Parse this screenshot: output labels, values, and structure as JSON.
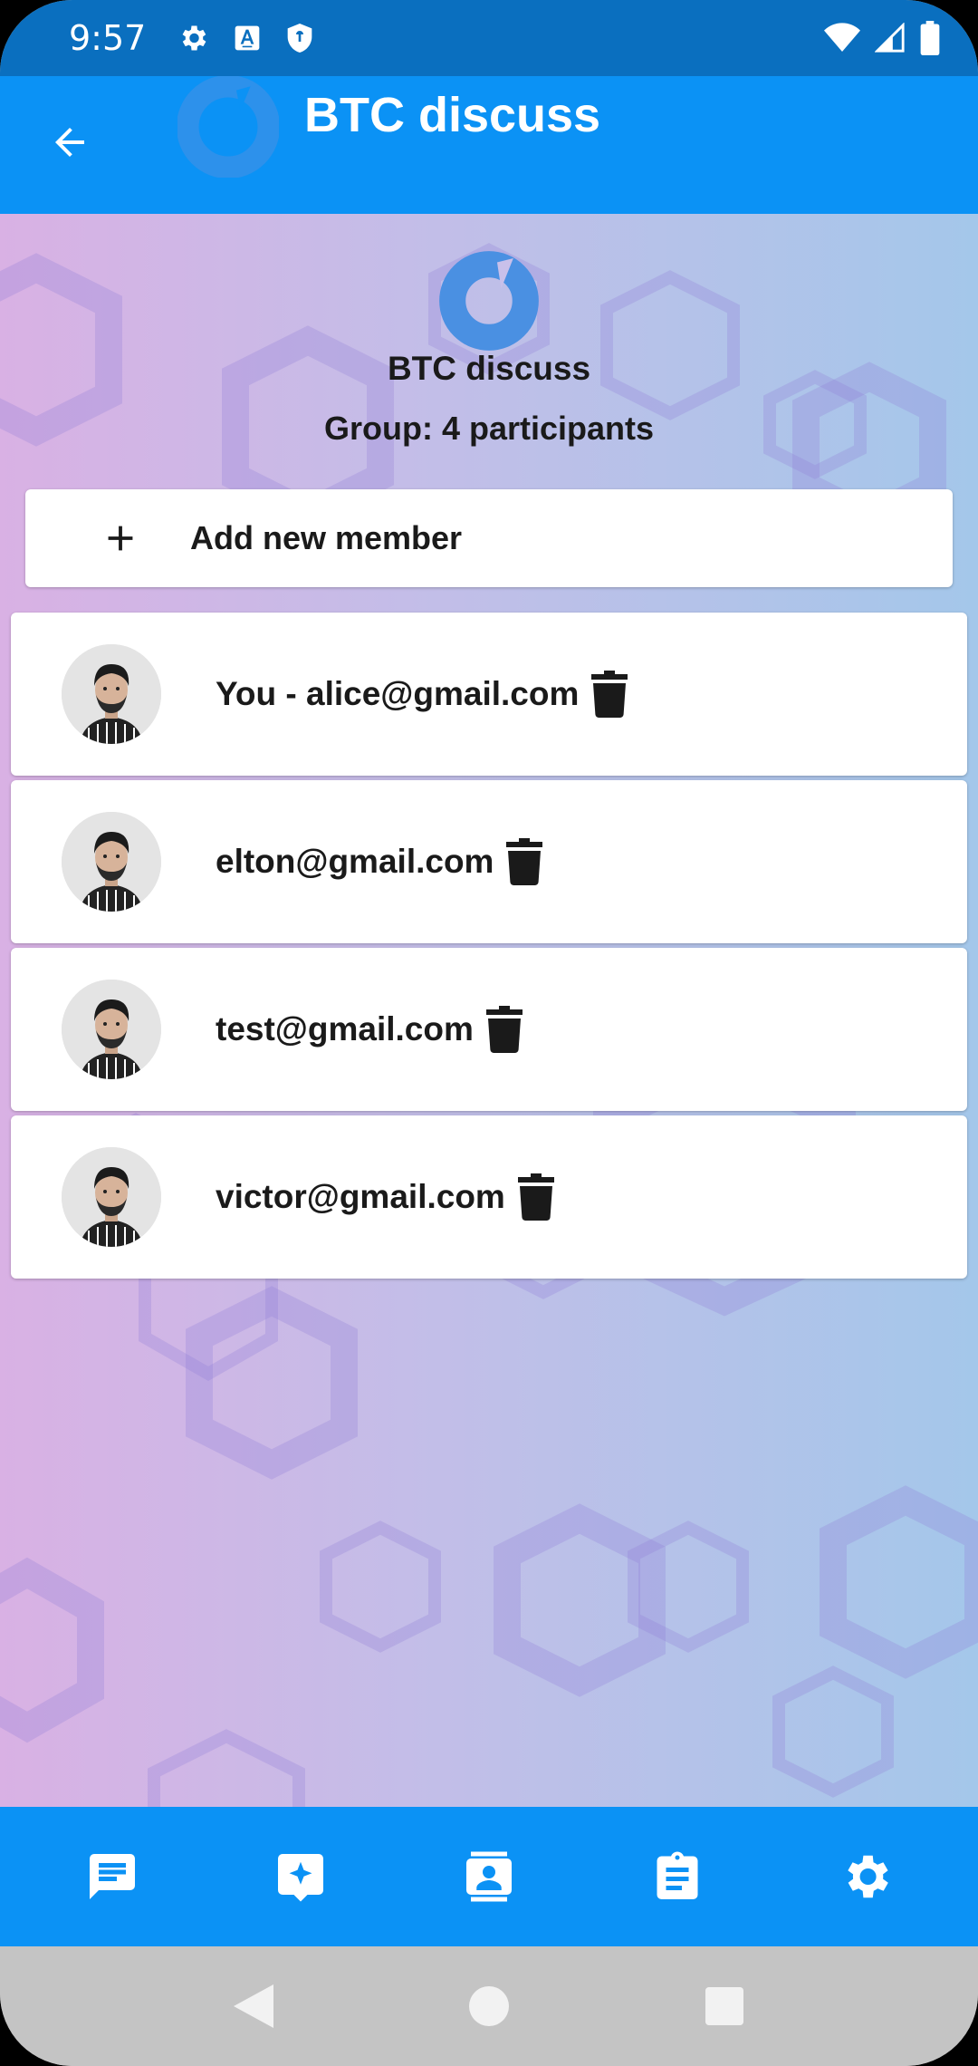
{
  "status_bar": {
    "time": "9:57",
    "left_icons": [
      "settings-icon",
      "font-a-icon",
      "shield-icon"
    ],
    "right_icons": [
      "wifi-icon",
      "signal-icon",
      "battery-icon"
    ]
  },
  "app_bar": {
    "title": "BTC discuss",
    "back_icon": "arrow-back-icon"
  },
  "group": {
    "name": "BTC discuss",
    "participants_text": "Group: 4 participants"
  },
  "add_member": {
    "label": "Add new member",
    "icon": "plus-icon"
  },
  "members": [
    {
      "email": "You - alice@gmail.com"
    },
    {
      "email": "elton@gmail.com"
    },
    {
      "email": "test@gmail.com"
    },
    {
      "email": "victor@gmail.com"
    }
  ],
  "bottom_nav": [
    "chat-icon",
    "sparkle-chat-icon",
    "contacts-icon",
    "clipboard-icon",
    "settings-icon"
  ],
  "colors": {
    "status_bar": "#0a6fbf",
    "app_bar": "#0b92f5",
    "accent_logo": "#4a90e2",
    "system_nav": "#c4c4c4"
  }
}
